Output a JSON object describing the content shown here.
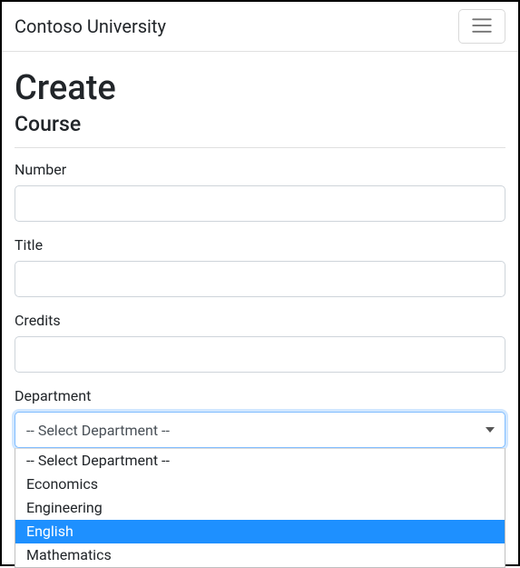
{
  "navbar": {
    "brand": "Contoso University"
  },
  "page": {
    "heading": "Create",
    "subheading": "Course"
  },
  "form": {
    "number": {
      "label": "Number",
      "value": ""
    },
    "title": {
      "label": "Title",
      "value": ""
    },
    "credits": {
      "label": "Credits",
      "value": ""
    },
    "department": {
      "label": "Department",
      "selected": "-- Select Department --",
      "options": [
        {
          "text": "-- Select Department --",
          "highlighted": false
        },
        {
          "text": "Economics",
          "highlighted": false
        },
        {
          "text": "Engineering",
          "highlighted": false
        },
        {
          "text": "English",
          "highlighted": true
        },
        {
          "text": "Mathematics",
          "highlighted": false
        }
      ]
    }
  }
}
